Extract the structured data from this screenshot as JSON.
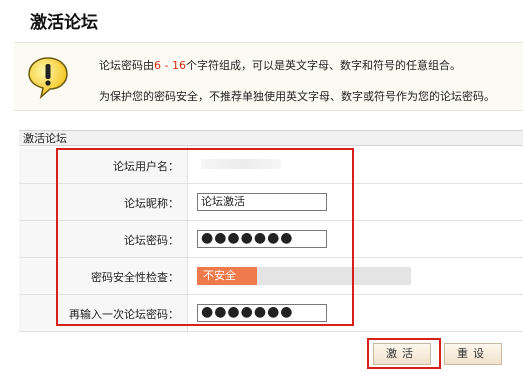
{
  "title": "激活论坛",
  "notice": {
    "line1_prefix": "论坛密码由",
    "line1_range": "6 - 16",
    "line1_suffix": "个字符组成，可以是英文字母、数字和符号的任意组合。",
    "line2": "为保护您的密码安全，不推荐单独使用英文字母、数字或符号作为您的论坛密码。",
    "icon": "warning-icon"
  },
  "section": {
    "header": "激活论坛"
  },
  "form": {
    "username_label": "论坛用户名：",
    "nickname_label": "论坛昵称：",
    "nickname_value": "论坛激活",
    "password_label": "论坛密码：",
    "password_value": "●●●●●●●",
    "strength_label": "密码安全性检查：",
    "strength_text": "不安全",
    "strength_level": 0.28,
    "confirm_label": "再输入一次论坛密码：",
    "confirm_value": "●●●●●●●"
  },
  "buttons": {
    "activate": "激活",
    "reset": "重设"
  },
  "colors": {
    "highlight": "#d8201a",
    "strength_weak": "#ef7b4d",
    "range_text": "#d8281c"
  }
}
